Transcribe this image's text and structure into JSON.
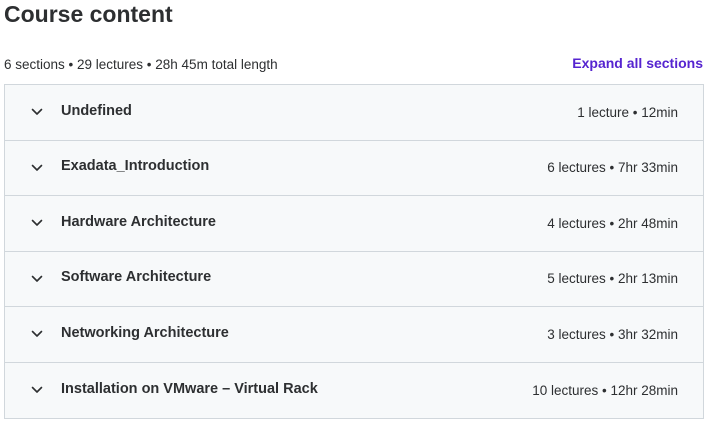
{
  "header": {
    "title": "Course content",
    "summary": "6 sections • 29 lectures • 28h 45m total length",
    "expand_label": "Expand all sections"
  },
  "icons": {
    "section_toggle": "chevron-down-icon"
  },
  "colors": {
    "accent": "#5624d0",
    "section_bg": "#f7f9fa",
    "border": "#d1d7dc",
    "text": "#2d2f31"
  },
  "sections": [
    {
      "title": "Undefined",
      "meta": "1 lecture • 12min"
    },
    {
      "title": "Exadata_Introduction",
      "meta": "6 lectures • 7hr 33min"
    },
    {
      "title": "Hardware Architecture",
      "meta": "4 lectures • 2hr 48min"
    },
    {
      "title": "Software Architecture",
      "meta": "5 lectures • 2hr 13min"
    },
    {
      "title": "Networking Architecture",
      "meta": "3 lectures • 3hr 32min"
    },
    {
      "title": "Installation on VMware – Virtual Rack",
      "meta": "10 lectures • 12hr 28min"
    }
  ]
}
